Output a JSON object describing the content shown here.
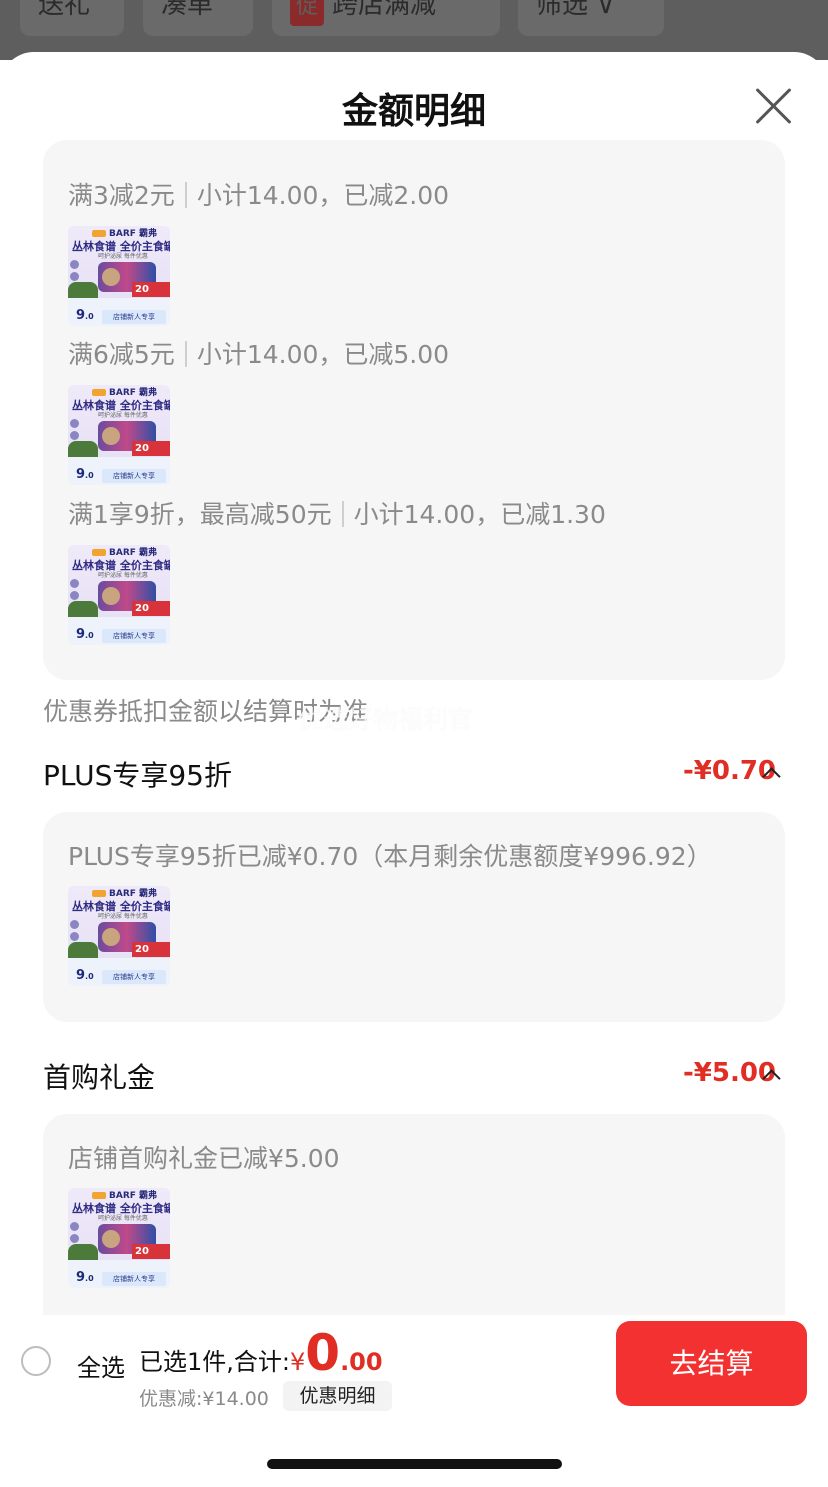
{
  "background_page": {
    "chips": [
      "送礼",
      "凑单",
      "跨店满减",
      "筛选"
    ],
    "promo_badge": "促",
    "filter_icon": "filter-icon"
  },
  "sheet": {
    "title": "金额明细",
    "close_icon": "close-icon"
  },
  "store_promotions": [
    {
      "rule": "满3减2元",
      "detail": "小计14.00，已减2.00"
    },
    {
      "rule": "满6减5元",
      "detail": "小计14.00，已减5.00"
    },
    {
      "rule": "满1享9折，最高减50元",
      "detail": "小计14.00，已减1.30"
    }
  ],
  "product_thumb": {
    "brand": "BARF 霸弗",
    "title": "丛林食谱 全价主食罐",
    "subtitle": "呵护泌尿 每件优惠",
    "badge_number": "20",
    "price_int": "9",
    "price_dec": ".0",
    "tag": "店铺新人专享"
  },
  "coupon_note": "优惠券抵扣金额以结算时为准",
  "watermark": "优选好物福利官",
  "plus_section": {
    "title": "PLUS专享95折",
    "amount": "-¥0.70",
    "detail": "PLUS专享95折已减¥0.70（本月剩余优惠额度¥996.92）"
  },
  "first_buy_section": {
    "title": "首购礼金",
    "amount": "-¥5.00",
    "detail": "店铺首购礼金已减¥5.00"
  },
  "bottom_bar": {
    "select_all": "全选",
    "selected_text": "已选1件,合计:",
    "currency": "¥",
    "total_int": "0",
    "total_dec": ".00",
    "discount_text": "优惠减:¥14.00",
    "detail_button": "优惠明细",
    "checkout_button": "去结算"
  },
  "colors": {
    "accent_red": "#e02e24",
    "checkout_bg": "#f33131",
    "panel_bg": "#f6f6f6",
    "muted_text": "#8a8a8a"
  }
}
